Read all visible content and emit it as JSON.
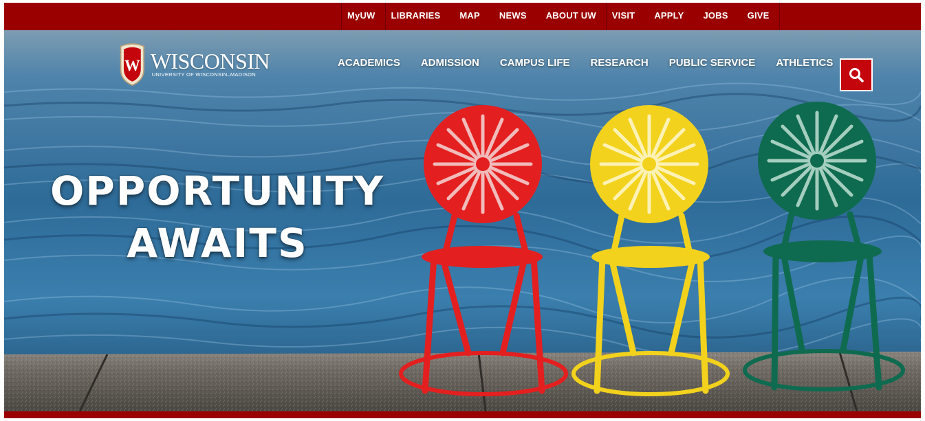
{
  "utility_nav": {
    "groups": [
      [
        {
          "label": "MyUW"
        }
      ],
      [
        {
          "label": "LIBRARIES"
        },
        {
          "label": "MAP"
        },
        {
          "label": "NEWS"
        },
        {
          "label": "ABOUT UW"
        }
      ],
      [
        {
          "label": "VISIT"
        },
        {
          "label": "APPLY"
        },
        {
          "label": "JOBS"
        },
        {
          "label": "GIVE"
        }
      ]
    ]
  },
  "logo": {
    "crest_letter": "W",
    "wordmark": "WISCONSIN",
    "subtitle": "UNIVERSITY OF WISCONSIN–MADISON"
  },
  "main_nav": {
    "items": [
      {
        "label": "ACADEMICS"
      },
      {
        "label": "ADMISSION"
      },
      {
        "label": "CAMPUS LIFE"
      },
      {
        "label": "RESEARCH"
      },
      {
        "label": "PUBLIC SERVICE"
      },
      {
        "label": "ATHLETICS"
      }
    ]
  },
  "search": {
    "icon": "search-icon"
  },
  "hero": {
    "headline_line1": "OPPORTUNITY",
    "headline_line2": "AWAITS"
  },
  "colors": {
    "brand_red": "#9b0000",
    "search_red": "#c5050c",
    "chair_red": "#e41f1f",
    "chair_yellow": "#f2d21c",
    "chair_green": "#0f6b4f"
  }
}
